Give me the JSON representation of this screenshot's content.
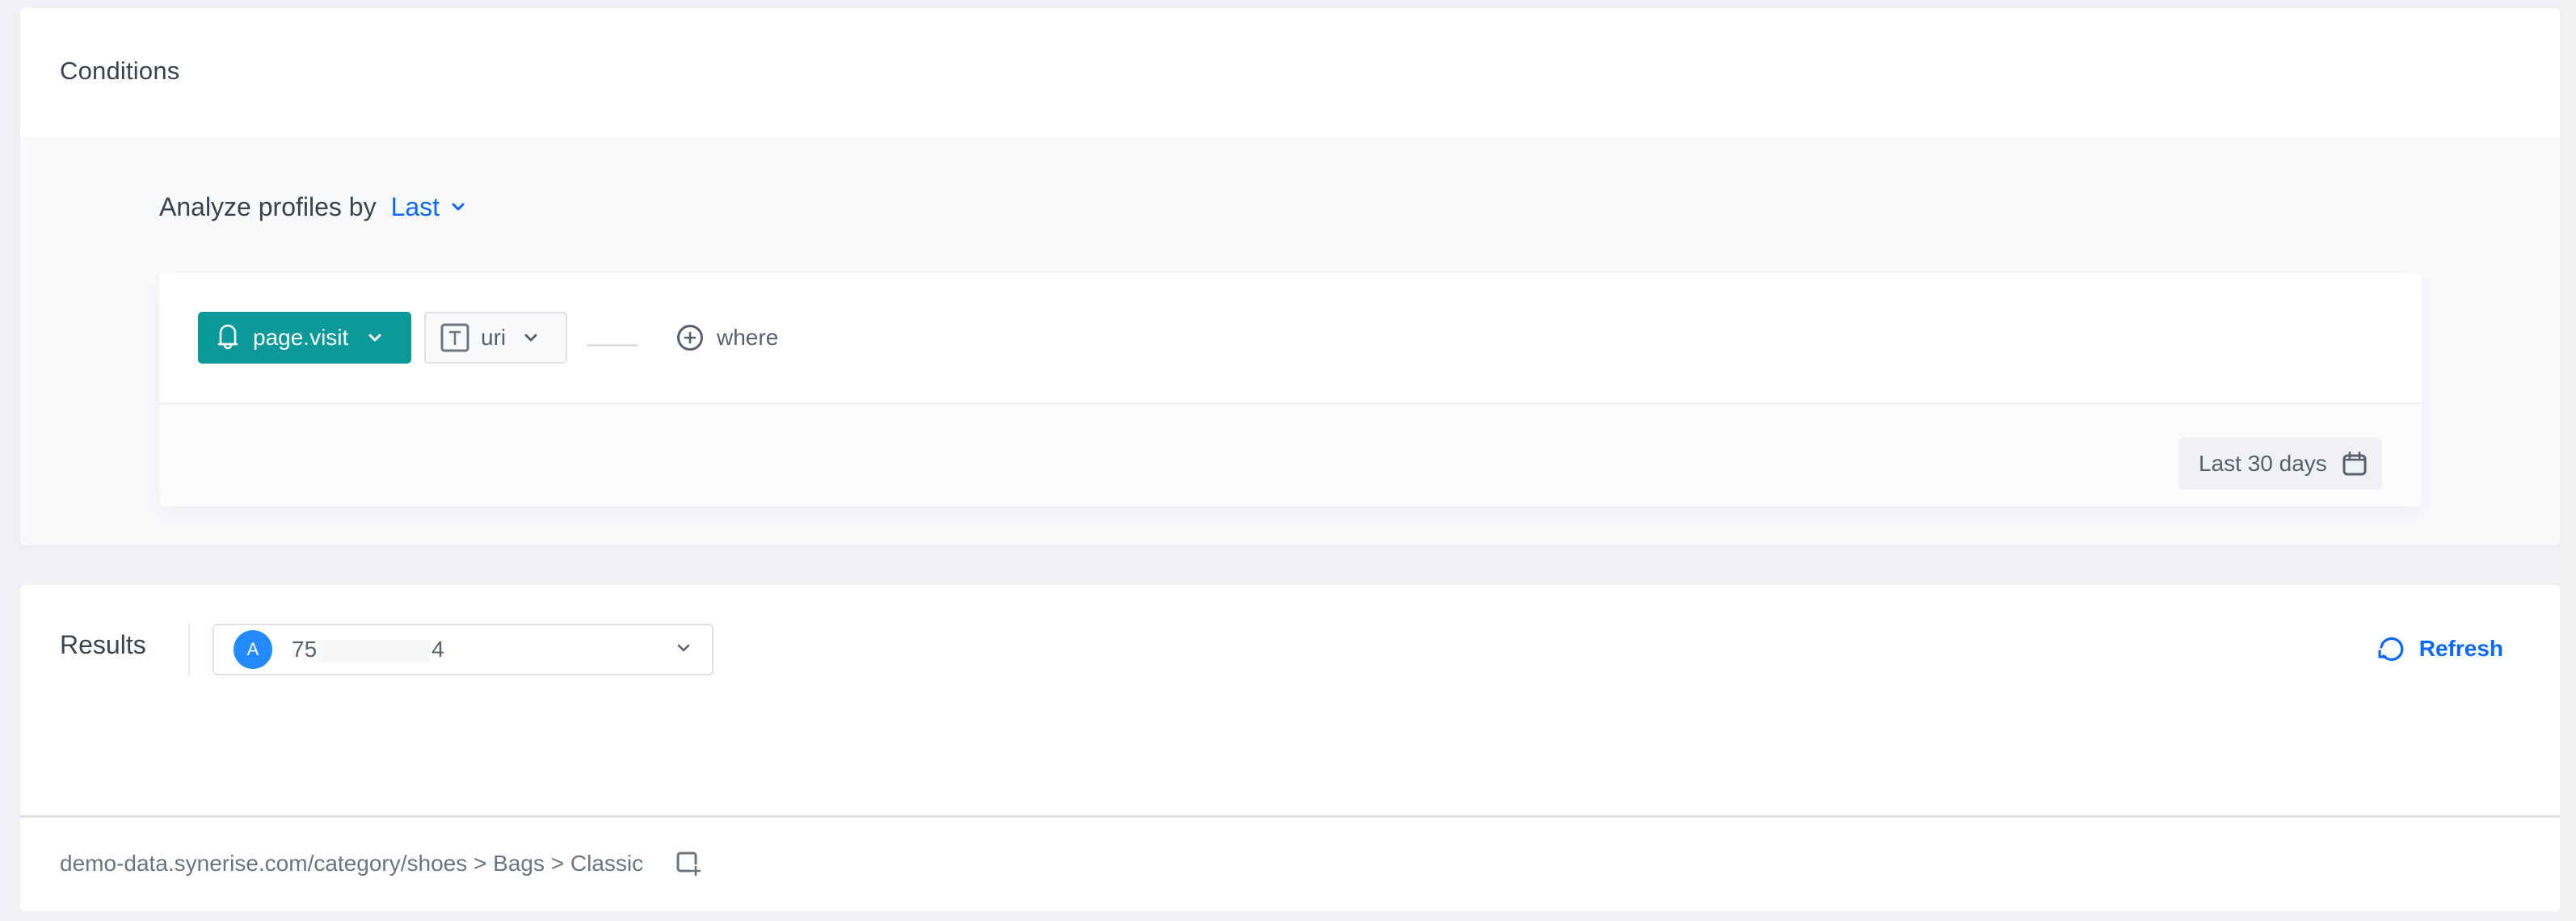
{
  "conditions": {
    "title": "Conditions",
    "analyze_label": "Analyze profiles by",
    "analyze_mode": "Last",
    "filter": {
      "event_label": "page.visit",
      "event_icon": "bell-icon",
      "parameter_label": "uri",
      "parameter_icon": "text-type-icon",
      "where_label": "where",
      "date_range_label": "Last 30 days"
    }
  },
  "results": {
    "title": "Results",
    "profile": {
      "avatar_letter": "A",
      "id_prefix": "75",
      "id_suffix": "4"
    },
    "refresh_label": "Refresh",
    "rows": [
      {
        "value": "demo-data.synerise.com/category/shoes > Bags > Classic"
      }
    ]
  },
  "colors": {
    "accent_blue": "#0b68ff",
    "event_green": "#0b9a99",
    "avatar_blue": "#238afe"
  }
}
